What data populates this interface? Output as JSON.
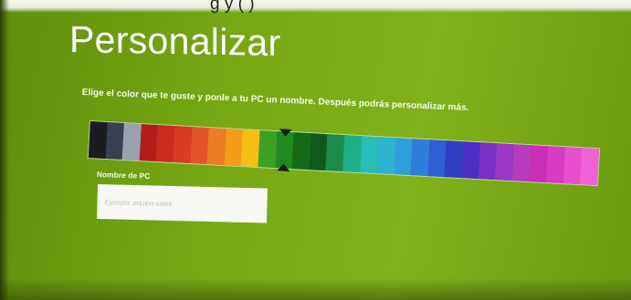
{
  "header": {
    "title": "Personalizar",
    "cut_off_top_text": "g                                y        (  )"
  },
  "instruction": "Elige el color que te guste y ponle a tu PC un nombre. Después podrás personalizar más.",
  "color_picker": {
    "swatches": [
      "#1c1c20",
      "#3a3f52",
      "#9aa2b0",
      "#b31d1b",
      "#cc2a20",
      "#d93b24",
      "#e45429",
      "#ee7b22",
      "#f39c1c",
      "#f5be14",
      "#3aa124",
      "#1f8a1d",
      "#156a17",
      "#0f5a1a",
      "#1c8a4a",
      "#1fae8a",
      "#28bdb6",
      "#2bb3d0",
      "#2f9fdc",
      "#2e7fdc",
      "#2e5fd6",
      "#3040c6",
      "#4c2fc4",
      "#7a2fc6",
      "#9e36c8",
      "#b63cc0",
      "#c92fb8",
      "#d93cc4",
      "#e84dd0",
      "#f061d8"
    ],
    "selected_index": 11,
    "accent_color": "#4da81c"
  },
  "pc_name": {
    "label": "Nombre de PC",
    "placeholder": "Ejemplo: equipo-sales",
    "value": ""
  }
}
